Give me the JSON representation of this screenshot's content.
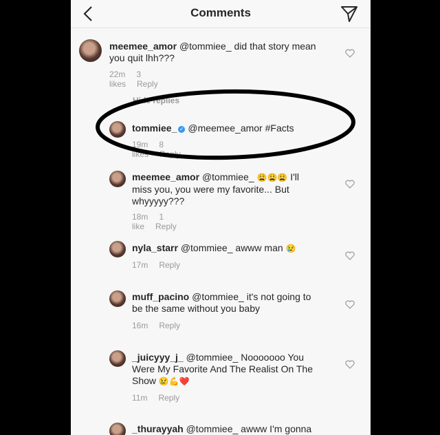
{
  "header": {
    "title": "Comments",
    "back_icon": "chevron-left-icon",
    "send_icon": "paper-plane-icon"
  },
  "comments": [
    {
      "user": "meemee_amor",
      "mention": "@tommiee_",
      "body": " did that story mean",
      "body2": "you quit lhh???",
      "time": "22m",
      "likes": "3 likes",
      "reply": "Reply"
    },
    {
      "user": "tommiee_",
      "verified": true,
      "mention": "@meemee_amor",
      "body": " #Facts",
      "time": "19m",
      "likes": "8 likes",
      "reply": "Reply"
    },
    {
      "user": "meemee_amor",
      "mention": "@tommiee_",
      "emojis": "😩😩😩",
      "body": " I'll",
      "body2": "miss you, you were my favorite... But",
      "body3": "whyyyyy???",
      "time": "18m",
      "likes": "1 like",
      "reply": "Reply"
    },
    {
      "user": "nyla_starr",
      "mention": "@tommiee_",
      "body": " awww man",
      "emoji": "😢",
      "time": "17m",
      "reply": "Reply"
    },
    {
      "user": "muff_pacino",
      "mention": "@tommiee_",
      "body": " it's not going to",
      "body2": "be the same without you baby",
      "time": "16m",
      "reply": "Reply"
    },
    {
      "user": "_juicyyy_j_",
      "mention": "@tommiee_",
      "body": "  Nooooooo You",
      "body2": "Were My Favorite And The Realist On The",
      "body3": "Show",
      "emojis": "😢💪❤️",
      "time": "11m",
      "reply": "Reply"
    },
    {
      "user": "_thurayyah",
      "mention": "@tommiee_",
      "body": " awww I'm gonna"
    }
  ],
  "hide_replies": "Hide replies",
  "colors": {
    "text": "#262626",
    "meta": "#999999",
    "verified": "#3897f0",
    "background": "#f7f7f7"
  }
}
